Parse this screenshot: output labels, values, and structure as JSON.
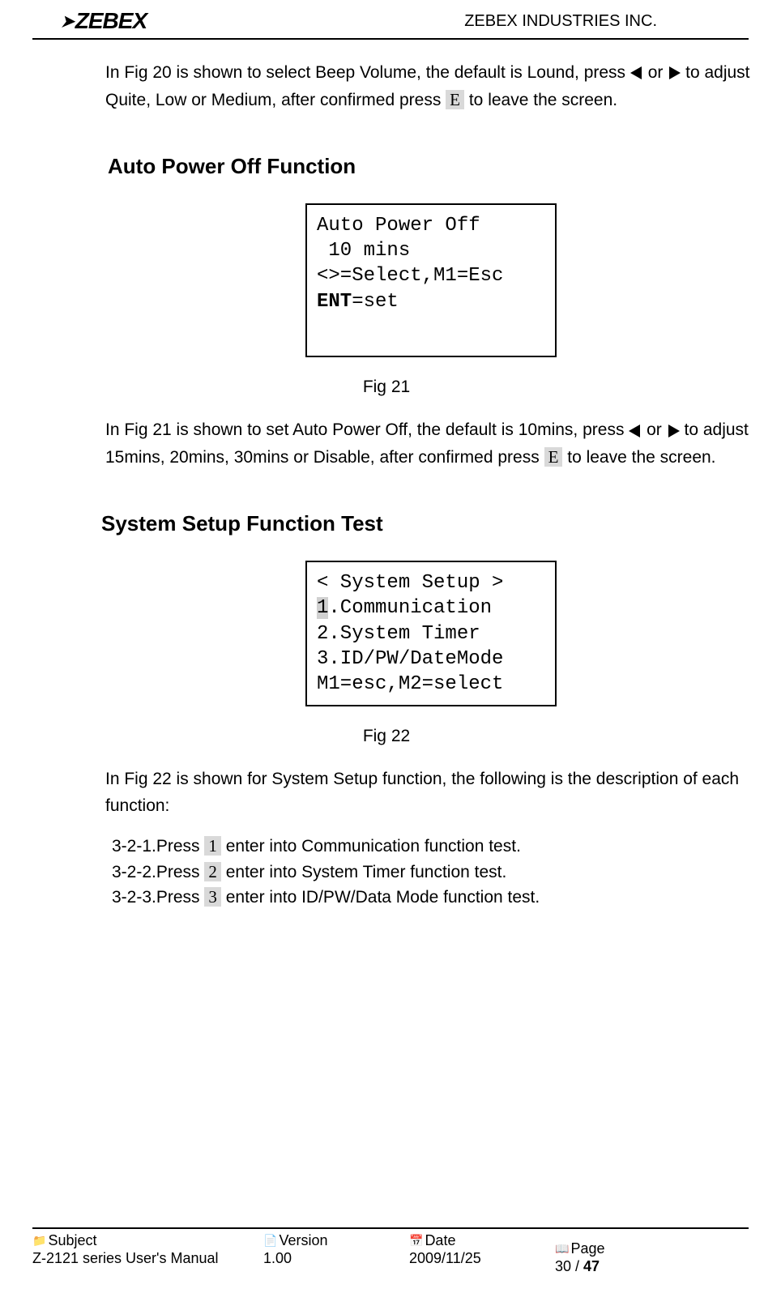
{
  "header": {
    "logo_text": "ZEBEX",
    "company": "ZEBEX INDUSTRIES INC."
  },
  "intro": {
    "para1_a": "In Fig 20 is shown to select Beep Volume, the default is Lound, press ",
    "para1_or": "or",
    "para1_b": " to adjust Quite, Low or Medium, after confirmed press ",
    "para1_key": "E",
    "para1_c": " to leave the screen."
  },
  "section1": {
    "title": "Auto Power Off Function",
    "screen": {
      "l1": "Auto Power Off",
      "l2": " 10 mins",
      "l3": "",
      "l4": "<>=Select,M1=Esc",
      "l5a": "ENT",
      "l5b": "=set"
    },
    "caption": "Fig 21",
    "para_a": "In Fig 21 is shown to set Auto Power Off, the default is 10mins, press ",
    "para_or": "or",
    "para_b": " to adjust 15mins, 20mins, 30mins or Disable, after confirmed press ",
    "para_key": "E",
    "para_c": " to leave the screen."
  },
  "section2": {
    "title": "System Setup Function Test",
    "screen": {
      "l1": "< System Setup >",
      "l2a": "1",
      "l2b": ".Communication",
      "l3": "2.System Timer",
      "l4": "3.ID/PW/DateMode",
      "l5": "M1=esc,M2=select"
    },
    "caption": "Fig 22",
    "para_a": "In Fig 22 is shown for System Setup function,",
    "para_b": " the following is the description of each function:",
    "items": {
      "i1_a": "3-2-1.Press ",
      "i1_key": "1",
      "i1_b": "  enter into Communication function test.",
      "i2_a": "3-2-2.Press ",
      "i2_key": "2",
      "i2_b": "  enter into System Timer function test.",
      "i3_a": "3-2-3.Press ",
      "i3_key": "3",
      "i3_b": "  enter into ID/PW/Data Mode function test."
    }
  },
  "footer": {
    "subject_label": "Subject",
    "subject_value": "Z-2121 series User's Manual",
    "version_label": "Version",
    "version_value": "1.00",
    "date_label": "Date",
    "date_value": "2009/11/25",
    "page_label": "Page",
    "page_a": "30",
    "page_slash": " / ",
    "page_b": "47"
  }
}
